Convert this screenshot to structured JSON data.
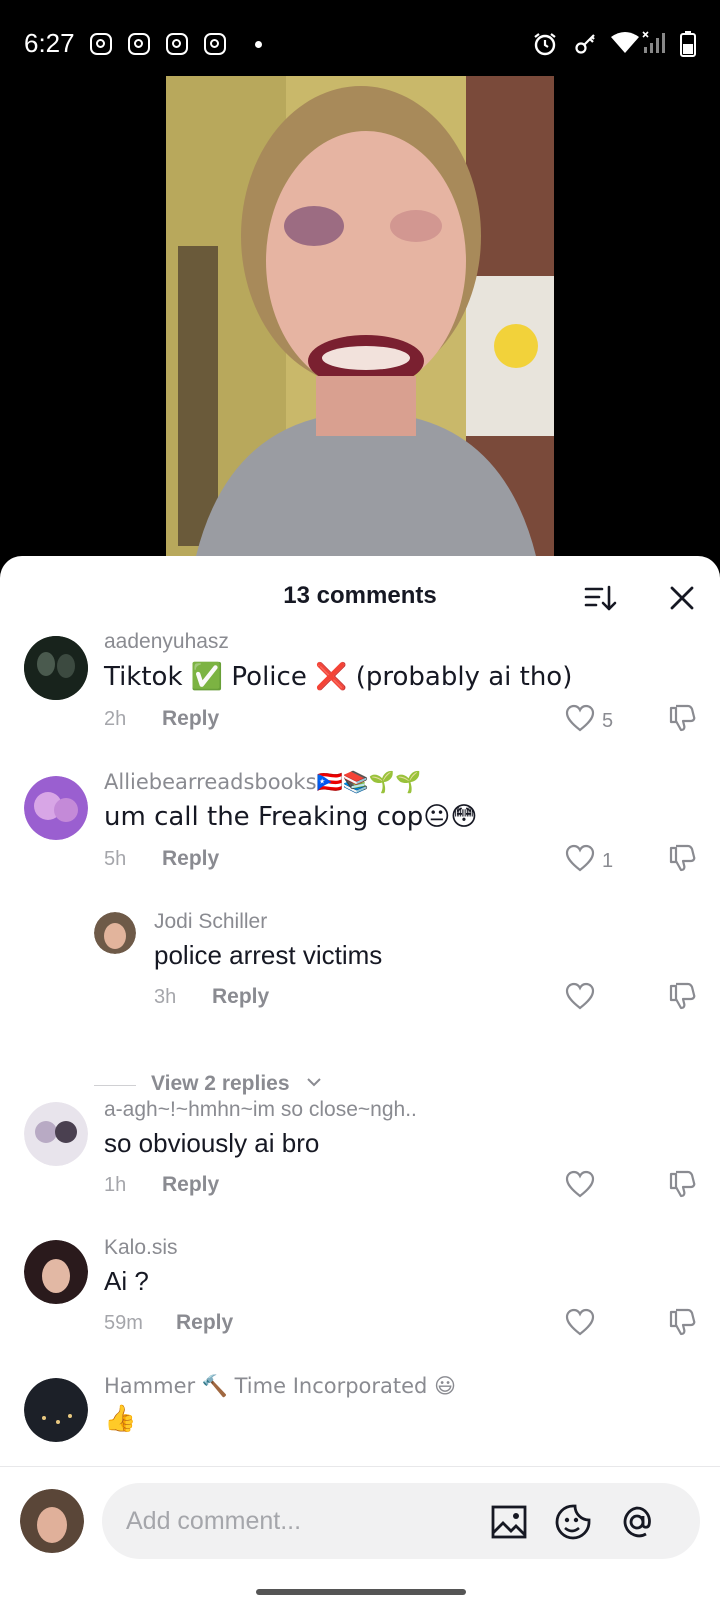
{
  "status_bar": {
    "time": "6:27",
    "notification_icons": [
      "instagram-icon",
      "instagram-icon",
      "instagram-icon",
      "instagram-icon"
    ]
  },
  "comments_sheet": {
    "title": "13 comments",
    "comments": [
      {
        "username": "aadenyuhasz",
        "text": "Tiktok ✅ Police ❌ (probably ai tho)",
        "time": "2h",
        "reply_label": "Reply",
        "likes": "5"
      },
      {
        "username": "Alliebearreadsbooks🇵🇷📚🌱🌱",
        "text": "um call the Freaking cop😐😳",
        "time": "5h",
        "reply_label": "Reply",
        "likes": "1"
      },
      {
        "username": "Jodi Schiller",
        "text": "police arrest victims",
        "time": "3h",
        "reply_label": "Reply",
        "likes": ""
      },
      {
        "username": "a-agh~!~hmhn~im so close~ngh..",
        "text": "so obviously ai bro",
        "time": "1h",
        "reply_label": "Reply",
        "likes": ""
      },
      {
        "username": "Kalo.sis",
        "text": "Ai ?",
        "time": "59m",
        "reply_label": "Reply",
        "likes": ""
      },
      {
        "username": "Hammer 🔨 Time Incorporated 😃",
        "text": "👍",
        "time": "",
        "reply_label": "",
        "likes": ""
      }
    ],
    "view_replies": "View 2 replies"
  },
  "composer": {
    "placeholder": "Add comment..."
  },
  "colors": {
    "sheet_bg": "#ffffff",
    "text_primary": "#161823",
    "text_secondary": "#8a8b91"
  }
}
